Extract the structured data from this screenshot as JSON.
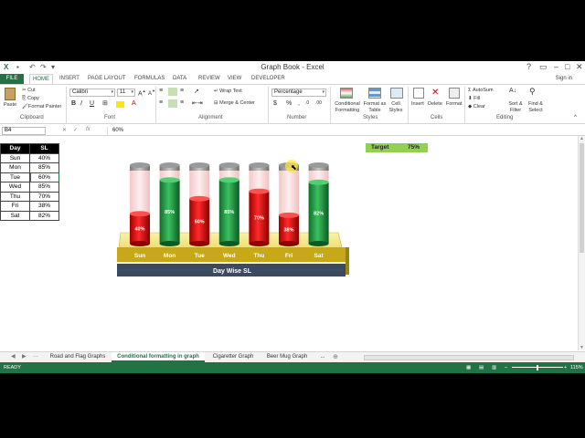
{
  "app": {
    "title": "Graph Book - Excel",
    "help": "?",
    "sign_in": "Sign in"
  },
  "tabs": [
    "FILE",
    "HOME",
    "INSERT",
    "PAGE LAYOUT",
    "FORMULAS",
    "DATA",
    "REVIEW",
    "VIEW",
    "DEVELOPER"
  ],
  "ribbon": {
    "clipboard": {
      "paste": "Paste",
      "cut": "Cut",
      "copy": "Copy",
      "format_painter": "Format Painter",
      "label": "Clipboard"
    },
    "font": {
      "name": "Calibri",
      "size": "11",
      "label": "Font",
      "bold": "B",
      "italic": "I",
      "underline": "U"
    },
    "alignment": {
      "wrap_text": "Wrap Text",
      "merge_center": "Merge & Center",
      "label": "Alignment"
    },
    "number": {
      "format": "Percentage",
      "currency": "$",
      "percent": "%",
      "comma": ",",
      "label": "Number"
    },
    "styles": {
      "conditional": "Conditional Formatting",
      "format_table": "Format as Table",
      "cell_styles": "Cell Styles",
      "label": "Styles"
    },
    "cells": {
      "insert": "Insert",
      "delete": "Delete",
      "format": "Format",
      "label": "Cells"
    },
    "editing": {
      "autosum": "AutoSum",
      "fill": "Fill",
      "clear": "Clear",
      "sort_filter": "Sort & Filter",
      "find_select": "Find & Select",
      "label": "Editing"
    }
  },
  "formula_bar": {
    "name_box": "B4",
    "fx": "fx",
    "value": "60%"
  },
  "table": {
    "headers": [
      "Day",
      "SL"
    ],
    "rows": [
      [
        "Sun",
        "40%"
      ],
      [
        "Mon",
        "85%"
      ],
      [
        "Tue",
        "60%"
      ],
      [
        "Wed",
        "85%"
      ],
      [
        "Thu",
        "70%"
      ],
      [
        "Fri",
        "38%"
      ],
      [
        "Sat",
        "82%"
      ]
    ]
  },
  "target": {
    "label": "Target",
    "value": "75%"
  },
  "chart_data": {
    "type": "bar",
    "title": "Day Wise SL",
    "categories": [
      "Sun",
      "Mon",
      "Tue",
      "Wed",
      "Thu",
      "Fri",
      "Sat"
    ],
    "values": [
      40,
      85,
      60,
      85,
      70,
      38,
      82
    ],
    "labels": [
      "40%",
      "85%",
      "60%",
      "85%",
      "70%",
      "38%",
      "82%"
    ],
    "target": 75,
    "ylim": [
      0,
      100
    ],
    "colors": {
      "below_target": "#e01010",
      "above_target": "#20a040",
      "base": "#f2e27a"
    }
  },
  "sheet_tabs": [
    "Road and Flag Graphs",
    "Conditional formatting in graph",
    "Cigaretter Graph",
    "Beer Mug Graph",
    "..."
  ],
  "active_sheet": 1,
  "status": {
    "ready": "READY",
    "zoom": "115%"
  },
  "colors": {
    "excel_green": "#217346"
  }
}
